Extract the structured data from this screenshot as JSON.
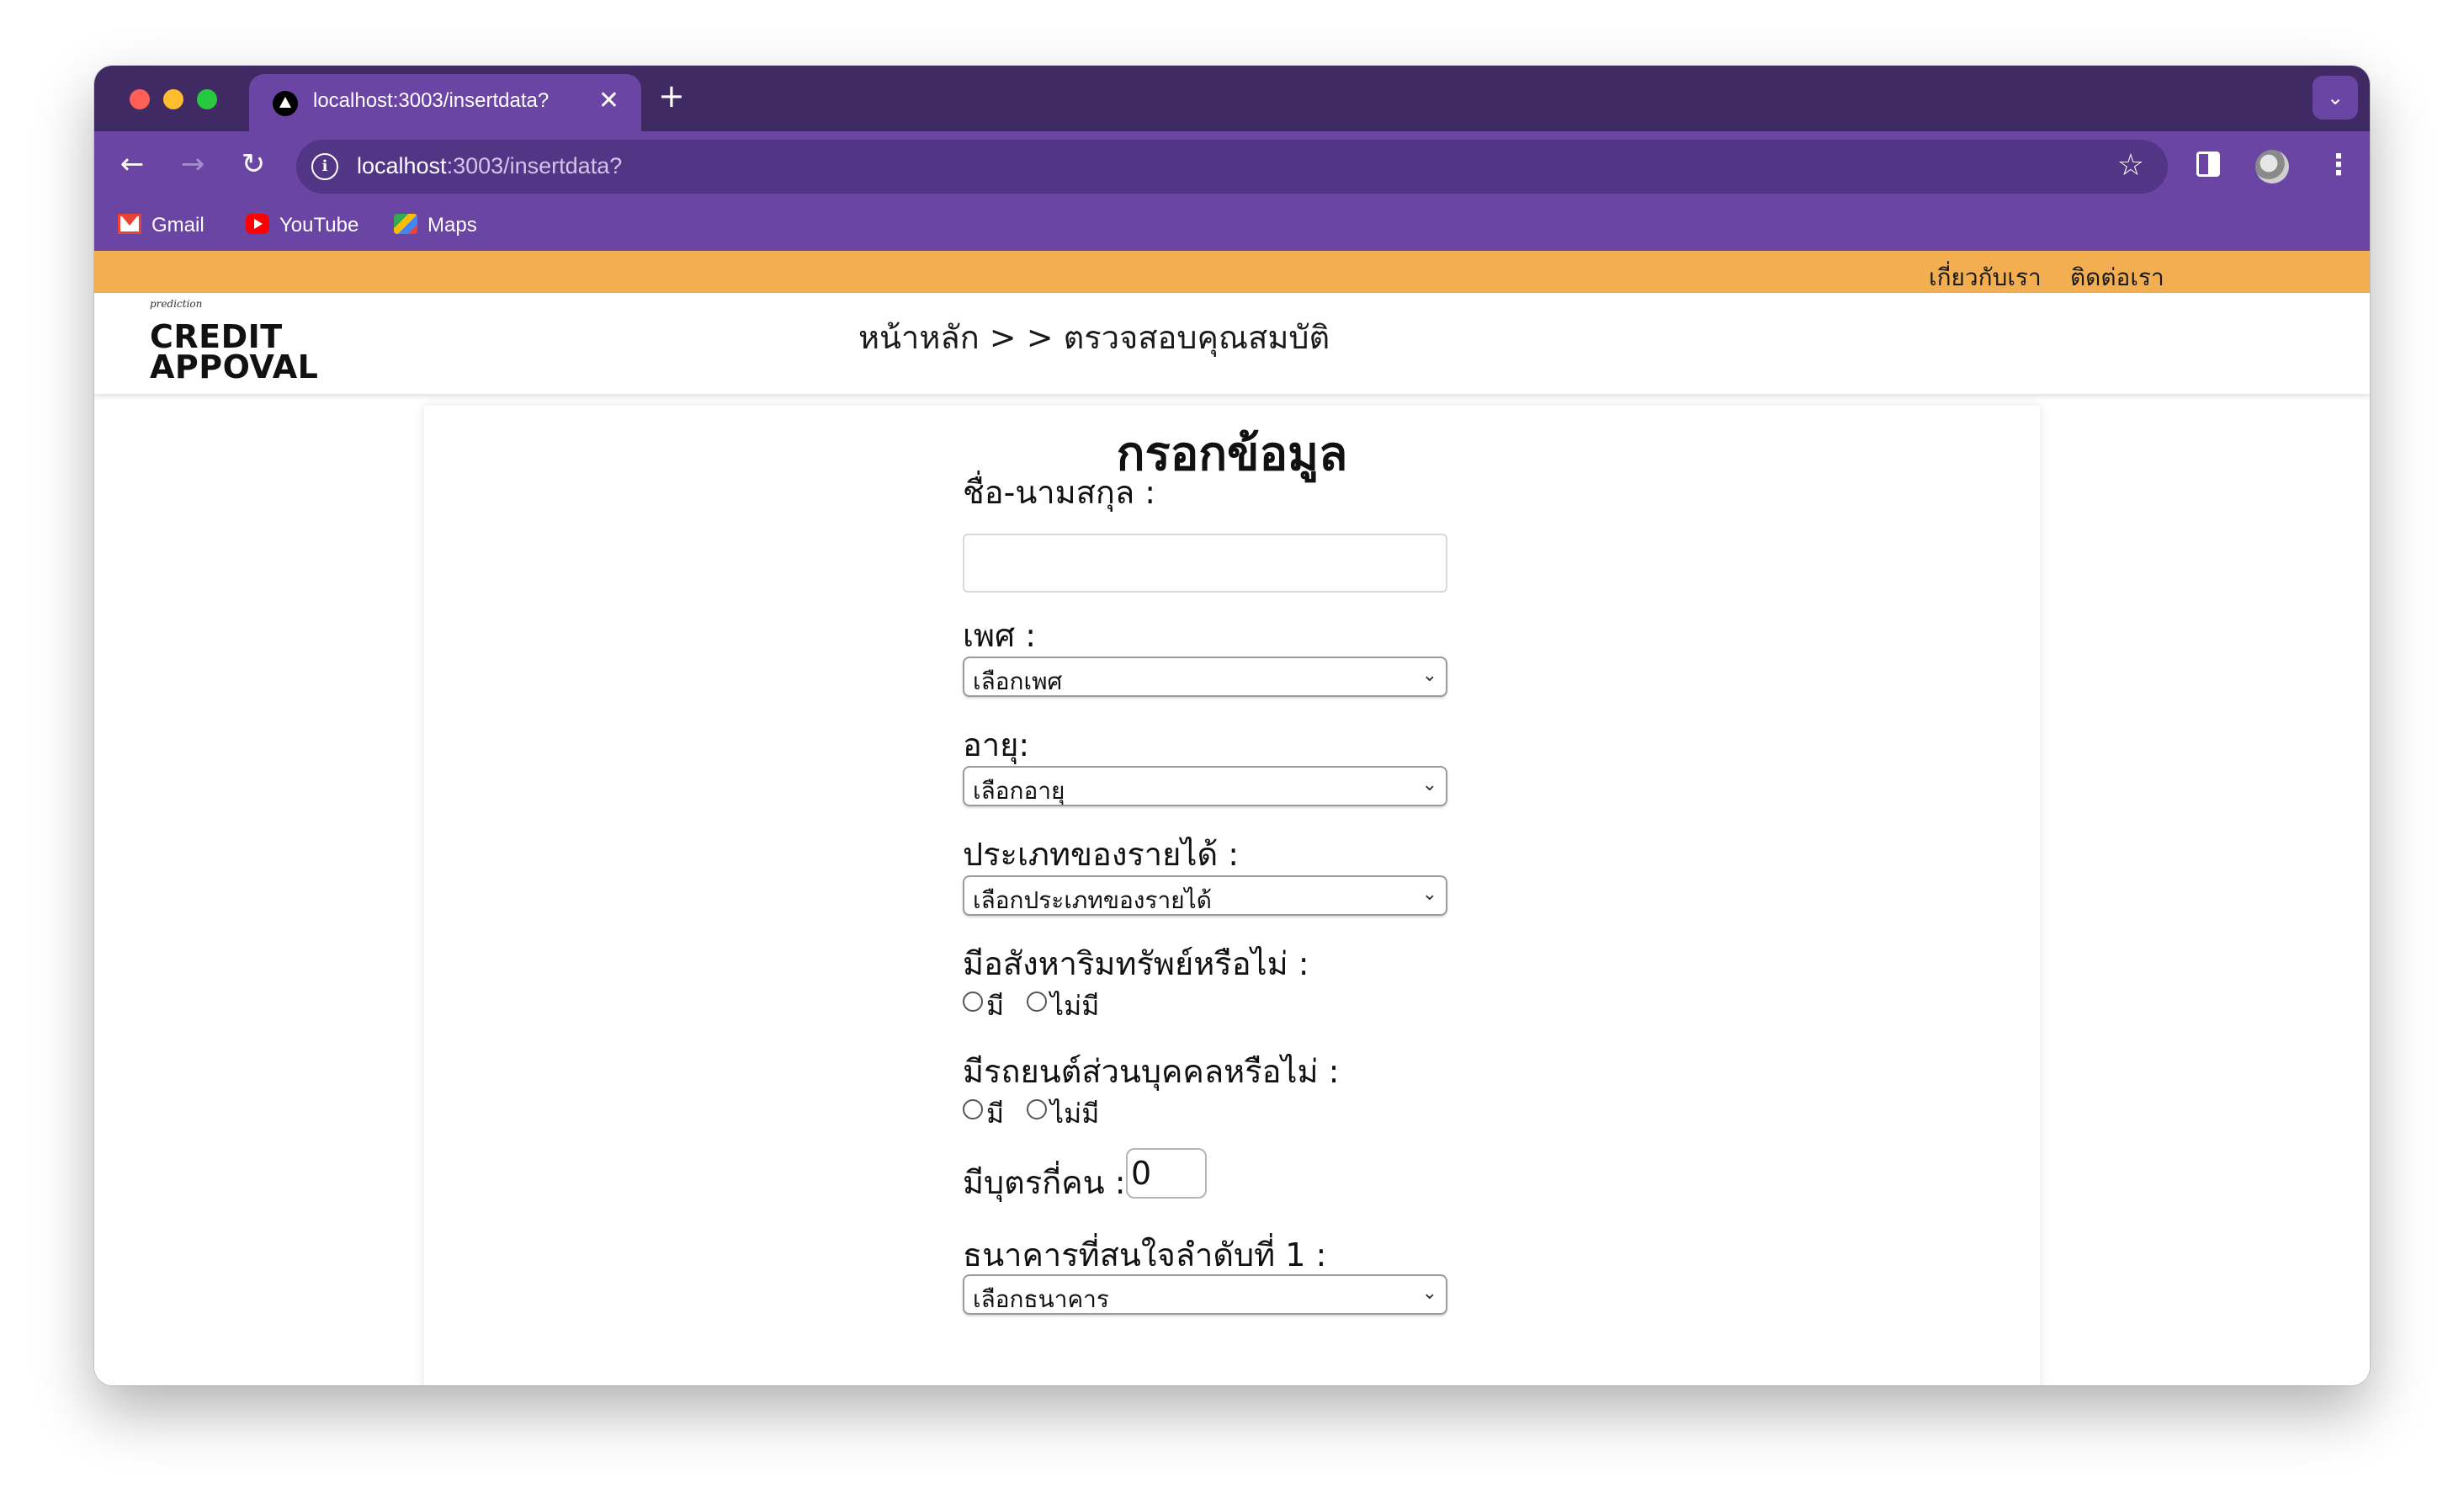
{
  "browser": {
    "tab_title": "localhost:3003/insertdata?",
    "tab_close": "✕",
    "new_tab": "+",
    "url_host": "localhost",
    "url_rest": ":3003/insertdata?",
    "bookmarks": [
      {
        "label": "Gmail"
      },
      {
        "label": "YouTube"
      },
      {
        "label": "Maps"
      }
    ]
  },
  "site": {
    "topbar_links": [
      "เกี่ยวกับเรา",
      "ติดต่อเรา"
    ],
    "logo_small": "prediction",
    "logo_line1": "CREDIT",
    "logo_line2": "APPOVAL",
    "breadcrumb": "หน้าหลัก > > ตรวจสอบคุณสมบัติ"
  },
  "form": {
    "title": "กรอกข้อมูล",
    "name_label": "ชื่อ-นามสกุล :",
    "name_value": "",
    "gender_label": "เพศ :",
    "gender_selected": "เลือกเพศ",
    "age_label": "อายุ:",
    "age_selected": "เลือกอายุ",
    "income_label": "ประเภทของรายได้ :",
    "income_selected": "เลือกประเภทของรายได้",
    "property_label": "มีอสังหาริมทรัพย์หรือไม่ :",
    "property_options": [
      "มี",
      "ไม่มี"
    ],
    "car_label": "มีรถยนต์ส่วนบุคคลหรือไม่ :",
    "car_options": [
      "มี",
      "ไม่มี"
    ],
    "children_label": "มีบุตรกี่คน :",
    "children_value": "0",
    "bank_label": "ธนาคารที่สนใจลำดับที่ 1 :",
    "bank_selected": "เลือกธนาคาร"
  },
  "colors": {
    "tabstrip": "#402a63",
    "toolbar": "#6a45a3",
    "topbar": "#f2ae51"
  }
}
